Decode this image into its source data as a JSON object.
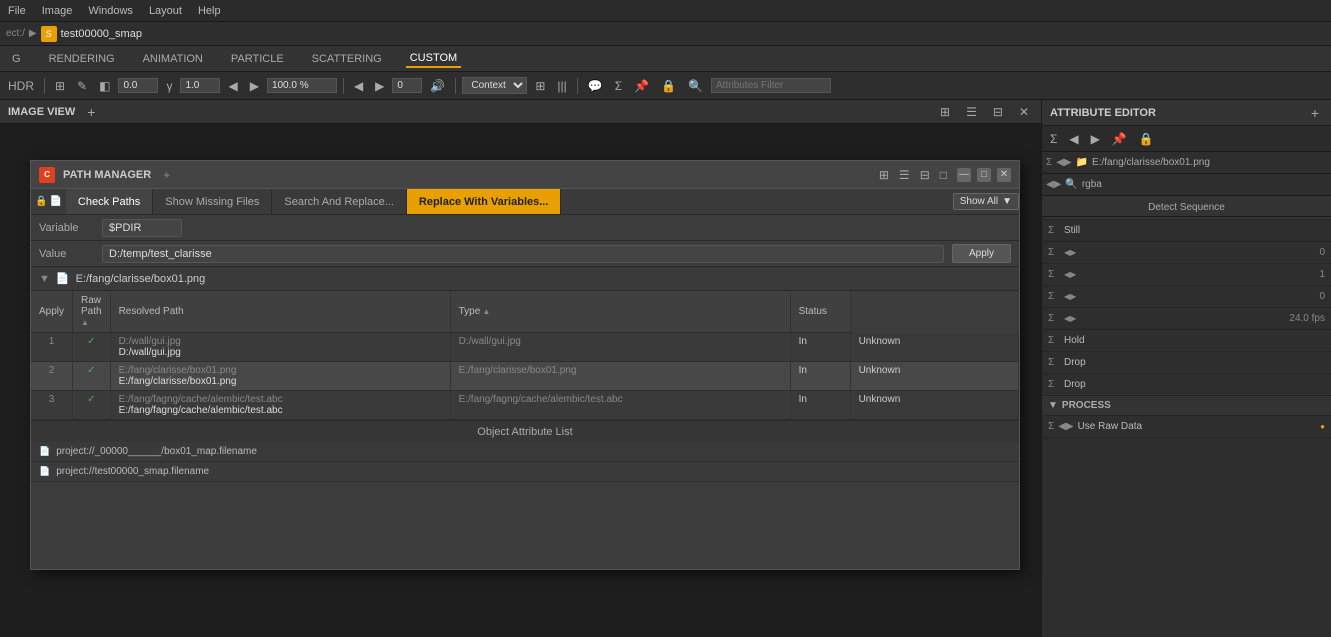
{
  "menu": {
    "items": [
      "File",
      "Image",
      "Windows",
      "Layout",
      "Help"
    ]
  },
  "breadcrumb": {
    "prefix": "ect:/",
    "arrow": "▶",
    "icon_label": "S",
    "title": "test00000_smap"
  },
  "tabs": {
    "items": [
      "G",
      "RENDERING",
      "ANIMATION",
      "PARTICLE",
      "SCATTERING",
      "CUSTOM"
    ]
  },
  "toolbar": {
    "display_value": "0.0",
    "gamma_value": "1.0",
    "zoom_value": "100.0 %",
    "audio_value": "0",
    "context_label": "Context",
    "filter_placeholder": "Attributes Filter"
  },
  "image_view_tab": {
    "label": "IMAGE VIEW",
    "plus": "+"
  },
  "path_manager": {
    "title": "PATH MANAGER",
    "plus": "+",
    "tabs": [
      "Check Paths",
      "Show Missing Files",
      "Search And Replace...",
      "Replace With Variables..."
    ],
    "active_tab_index": 3,
    "show_all": "Show All",
    "variable_label": "Variable",
    "variable_value": "$PDIR",
    "value_label": "Value",
    "value_input": "D:/temp/test_clarisse",
    "apply_btn": "Apply",
    "current_path": "E:/fang/clarisse/box01.png",
    "table": {
      "columns": [
        "Apply",
        "Raw Path",
        "Resolved Path",
        "Type",
        "Status"
      ],
      "rows": [
        {
          "num": "1",
          "apply": "✓",
          "raw_path_top": "D:/wall/gui.jpg",
          "raw_path_bottom": "D:/wall/gui.jpg",
          "resolved_path": "D:/wall/gui.jpg",
          "type": "In",
          "status": "Unknown"
        },
        {
          "num": "2",
          "apply": "✓",
          "raw_path_top": "E:/fang/clarisse/box01.png",
          "raw_path_bottom": "E:/fang/clarisse/box01.png",
          "resolved_path": "E:/fang/clarisse/box01.png",
          "type": "In",
          "status": "Unknown"
        },
        {
          "num": "3",
          "apply": "✓",
          "raw_path_top": "E:/fang/fagng/cache/alembic/test.abc",
          "raw_path_bottom": "E:/fang/fagng/cache/alembic/test.abc",
          "resolved_path": "E:/fang/fagng/cache/alembic/test.abc",
          "type": "In",
          "status": "Unknown"
        }
      ]
    },
    "object_attribute_list": "Object Attribute List",
    "object_items": [
      "project://_00000______/box01_map.filename",
      "project://test00000_smap.filename"
    ]
  },
  "attr_editor": {
    "title": "ATTRIBUTE EDITOR",
    "plus": "+",
    "path": "E:/fang/clarisse/box01.png",
    "search_label": "rgba",
    "detect_sequence": "Detect Sequence",
    "fields": [
      {
        "sigma": "Σ",
        "label": "Still",
        "value": ""
      },
      {
        "sigma": "Σ",
        "arrow": "◀▶",
        "label": "",
        "value": "0"
      },
      {
        "sigma": "Σ",
        "arrow": "◀▶",
        "label": "",
        "value": "1"
      },
      {
        "sigma": "Σ",
        "arrow": "◀▶",
        "label": "",
        "value": "0"
      },
      {
        "sigma": "Σ",
        "arrow": "◀▶",
        "label": "",
        "value": "24.0 fps"
      },
      {
        "sigma": "Σ",
        "label": "Hold",
        "value": ""
      },
      {
        "sigma": "Σ",
        "label": "Drop",
        "value": ""
      },
      {
        "sigma": "Σ",
        "label": "Drop",
        "value": ""
      }
    ],
    "process_section": "PROCESS",
    "use_raw_data": "Use Raw Data"
  }
}
